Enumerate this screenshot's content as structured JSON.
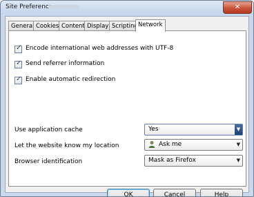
{
  "window": {
    "title": "Site Preferences",
    "close_glyph": "✕"
  },
  "tabs": [
    {
      "label": "General"
    },
    {
      "label": "Cookies"
    },
    {
      "label": "Content"
    },
    {
      "label": "Display"
    },
    {
      "label": "Scripting"
    },
    {
      "label": "Network",
      "active": true
    }
  ],
  "checkboxes": [
    {
      "label": "Encode international web addresses with UTF-8",
      "checked": true
    },
    {
      "label": "Send referrer information",
      "checked": true
    },
    {
      "label": "Enable automatic redirection",
      "checked": true
    }
  ],
  "settings": {
    "app_cache": {
      "label": "Use application cache",
      "value": "Yes"
    },
    "location": {
      "label": "Let the website know my location",
      "value": "Ask me",
      "icon": "person-location-icon"
    },
    "browser_id": {
      "label": "Browser identification",
      "value": "Mask as Firefox"
    }
  },
  "buttons": {
    "ok": "OK",
    "cancel": "Cancel",
    "help": "Help"
  },
  "colors": {
    "accent": "#3c7fb1",
    "titlebar": "#c9d8ec",
    "close": "#c9533a"
  }
}
